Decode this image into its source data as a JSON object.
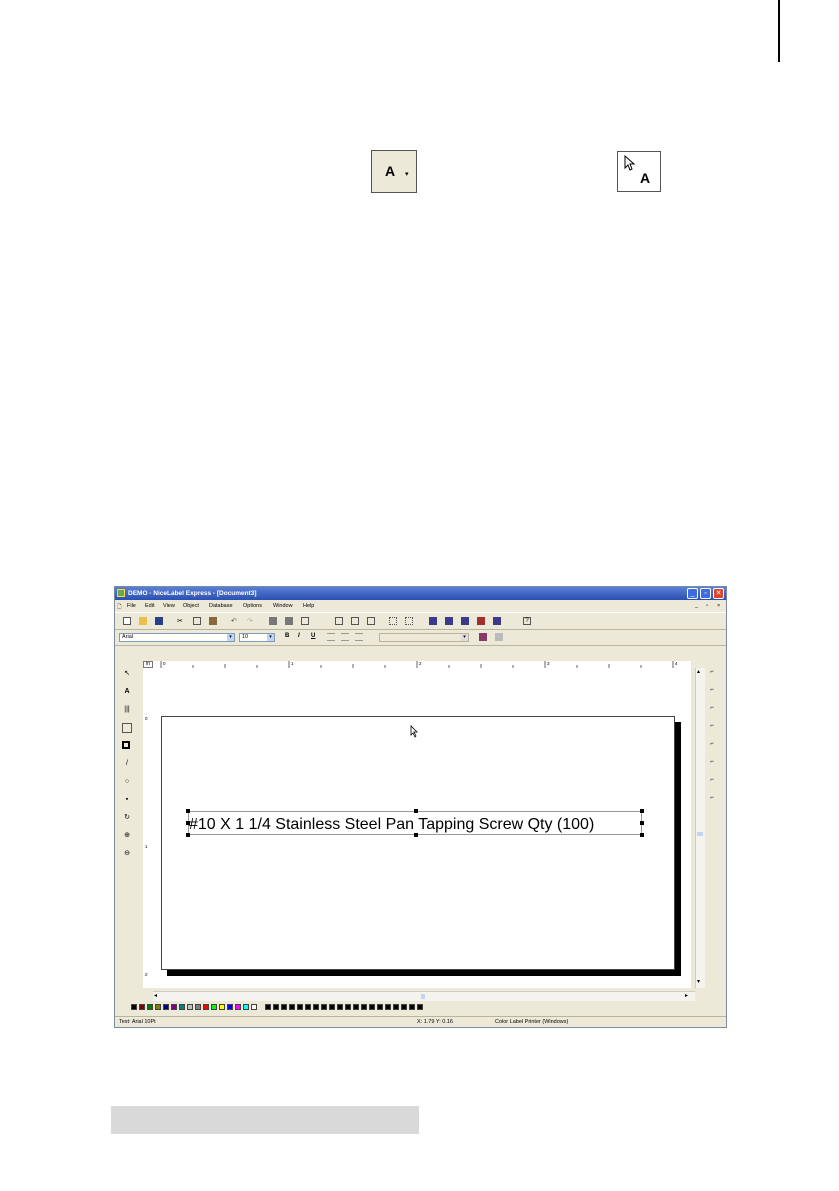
{
  "tool_icons": {
    "text_tool_label": "A",
    "text_tool_arrow": "▾",
    "pointer_text_label": "A"
  },
  "window": {
    "title": "DEMO - NiceLabel Express - [Document3]",
    "menu": [
      "File",
      "Edit",
      "View",
      "Object",
      "Database",
      "Options",
      "Window",
      "Help"
    ],
    "font_name": "Arial",
    "font_size": "10",
    "bold_label": "B",
    "italic_label": "I",
    "underline_label": "U",
    "ruler_corner": "in",
    "ruler_marks": [
      "0",
      "1",
      "2",
      "3",
      "4"
    ],
    "vruler_marks": [
      "0",
      "1",
      "2"
    ],
    "label_text": "#10 X 1 1/4 Stainless Steel Pan Tapping Screw Qty (100)",
    "status": {
      "font_info": "Text: Arial 10Pt",
      "coords": "X: 1.79 Y: 0.16",
      "printer": "Color Label Printer (Windows)"
    }
  },
  "colors": {
    "titlebar": "#2a4fb0",
    "window_bg": "#ece9d8",
    "close_button": "#d9462b"
  },
  "palette_colors": [
    "#000000",
    "#800000",
    "#008000",
    "#808000",
    "#000080",
    "#800080",
    "#008080",
    "#c0c0c0",
    "#808080",
    "#ff0000",
    "#00ff00",
    "#ffff00",
    "#0000ff",
    "#ff00ff",
    "#00ffff",
    "#ffffff",
    "#000000",
    "#000000",
    "#000000",
    "#000000",
    "#000000",
    "#000000",
    "#000000",
    "#000000",
    "#000000",
    "#000000",
    "#000000",
    "#000000",
    "#000000",
    "#000000",
    "#000000",
    "#000000",
    "#000000",
    "#000000",
    "#000000",
    "#000000"
  ]
}
